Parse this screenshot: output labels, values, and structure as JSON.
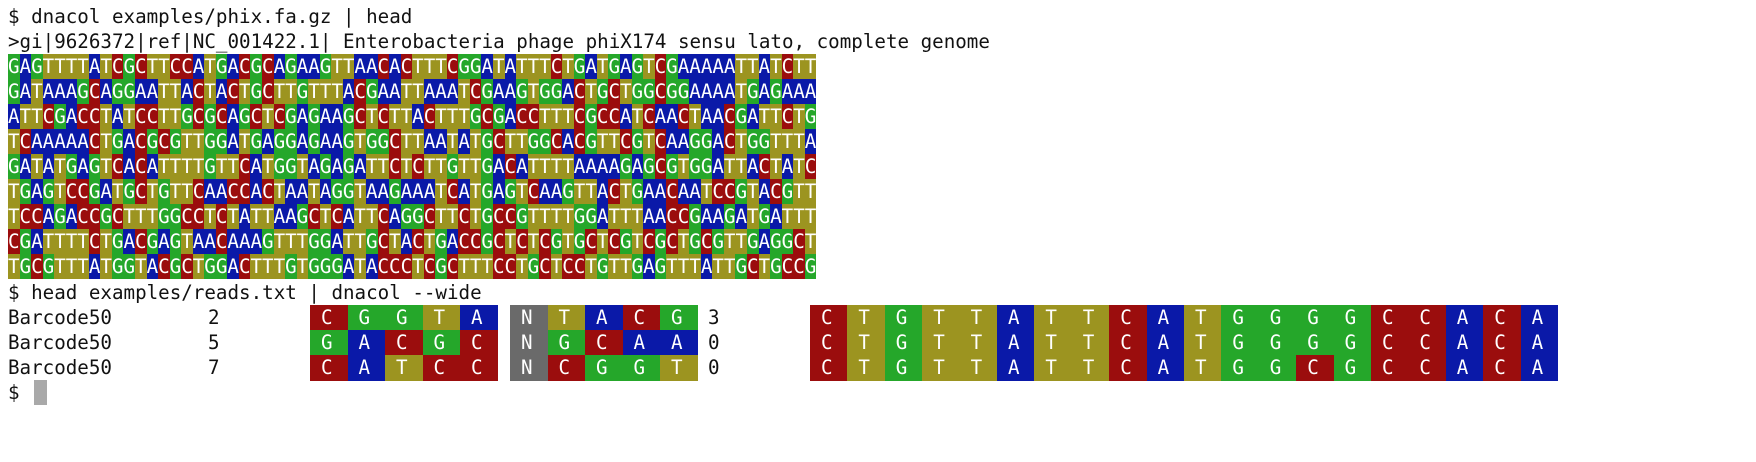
{
  "colors": {
    "A": "#0a19a8",
    "C": "#9b0d0d",
    "G": "#25a72a",
    "T": "#9c9420",
    "N": "#6a6a6a",
    "cursor": "#a9a9a9"
  },
  "cmd1": "$ dnacol examples/phix.fa.gz | head",
  "header": ">gi|9626372|ref|NC_001422.1| Enterobacteria phage phiX174 sensu lato, complete genome",
  "seq_lines": [
    "GAGTTTTATCGCTTCCATGACGCAGAAGTTAACACTTTCGGATATTTCTGATGAGTCGAAAAATTATCTT",
    "GATAAAGCAGGAATTACTACTGCTTGTTTACGAATTAAATCGAAGTGGACTGCTGGCGGAAAATGAGAAA",
    "ATTCGACCTATCCTTGCGCAGCTCGAGAAGCTCTTACTTTGCGACCTTTCGCCATCAACTAACGATTCTG",
    "TCAAAAACTGACGCGTTGGATGAGGAGAAGTGGCTTAATATGCTTGGCACGTTCGTCAAGGACTGGTTTA",
    "GATATGAGTCACATTTTGTTCATGGTAGAGATTCTCTTGTTGACATTTTAAAAGAGCGTGGATTACTATC",
    "TGAGTCCGATGCTGTTCAACCACTAATAGGTAAGAAATCATGAGTCAAGTTACTGAACAATCCGTACGTT",
    "TCCAGACCGCTTTGGCCTCTATTAAGCTCATTCAGGCTTCTGCCGTTTTGGATTTAACCGAAGATGATTT",
    "CGATTTTCTGACGAGTAACAAAGTTTGGATTGCTACTGACCGCTCTCGTGCTCGTCGCTGCGTTGAGGCT",
    "TGCGTTTATGGTACGCTGGACTTTGTGGGATACCCTCGCTTTCCTGCTCCTGTTGAGTTTATTGCTGCCG"
  ],
  "cmd2": "$ head examples/reads.txt | dnacol --wide",
  "reads": [
    {
      "name": "Barcode50",
      "count": "2",
      "bc1": "CGGTA",
      "bc2": "NTACG",
      "num": "3",
      "read": "CTGTTATTCATGGGGCCACA"
    },
    {
      "name": "Barcode50",
      "count": "5",
      "bc1": "GACGC",
      "bc2": "NGCAA",
      "num": "0",
      "read": "CTGTTATTCATGGGGCCACA"
    },
    {
      "name": "Barcode50",
      "count": "7",
      "bc1": "CATCC",
      "bc2": "NCGGT",
      "num": "0",
      "read": "CTGTTATTCATGGCGCCACA"
    }
  ],
  "prompt": "$"
}
